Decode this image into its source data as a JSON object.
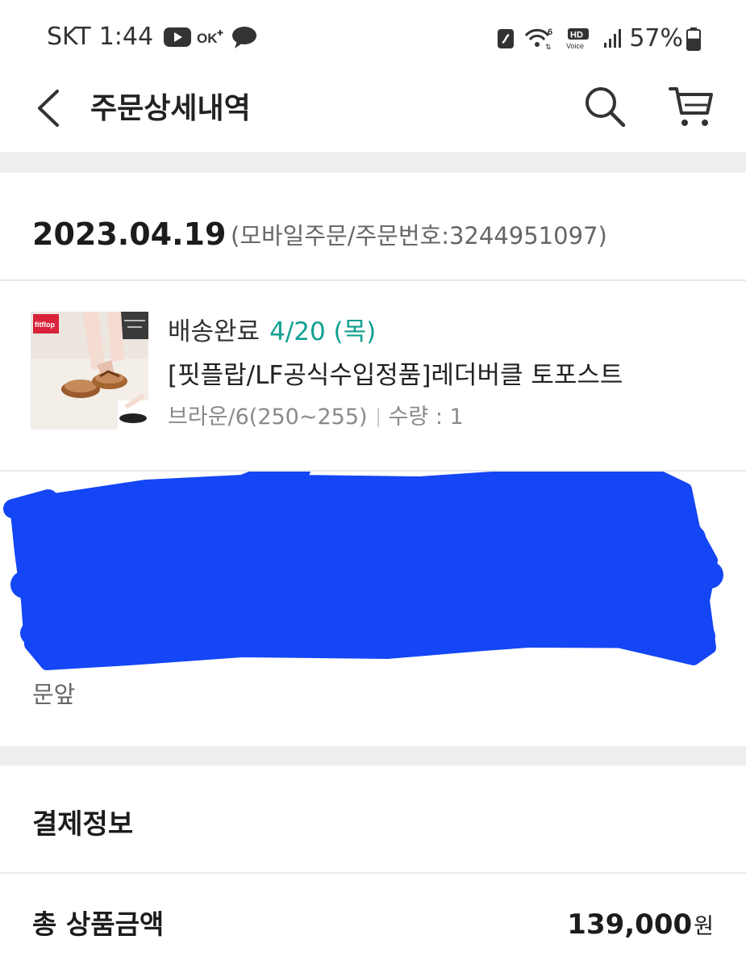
{
  "status_bar": {
    "carrier": "SKT",
    "time": "1:44",
    "ok_badge": "OK",
    "wifi_badge": "6",
    "hd_badge": "HD",
    "voice_badge": "Voice",
    "battery": "57%",
    "icons": [
      "youtube-icon",
      "ok-cashbag-icon",
      "talk-bubble-icon",
      "nfc-icon",
      "wifi-icon",
      "hd-voice-icon",
      "signal-icon",
      "battery-icon"
    ]
  },
  "header": {
    "title": "주문상세내역",
    "icons": [
      "back-chevron-icon",
      "search-icon",
      "cart-icon"
    ]
  },
  "order": {
    "date": "2023.04.19",
    "meta": "(모바일주문/주문번호:3244951097)"
  },
  "product": {
    "delivery_status": "배송완료",
    "delivery_date": "4/20 (목)",
    "name": "[핏플랍/LF공식수입정품]레더버클 토포스트",
    "option": "브라운/6(250~255)",
    "quantity": "수량 : 1",
    "thumbnail_brand": "fitflop"
  },
  "address": {
    "visible_tail": "문앞"
  },
  "payment": {
    "heading": "결제정보",
    "total_label": "총 상품금액",
    "total_amount": "139,000",
    "currency": "원"
  },
  "colors": {
    "accent_teal": "#12a090",
    "redaction_blue": "#1446f5",
    "band_gray": "#eeeeee"
  }
}
